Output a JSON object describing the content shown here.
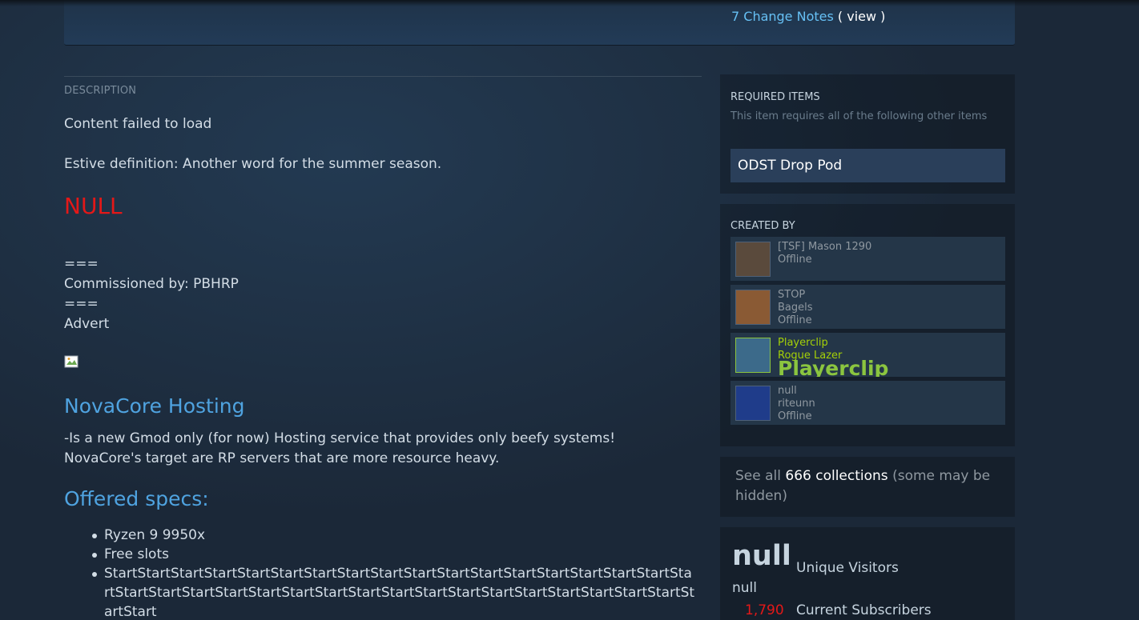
{
  "header": {
    "change_notes_link": "7 Change Notes",
    "view_text": "( view )"
  },
  "description": {
    "section_title": "DESCRIPTION",
    "lines": [
      "Content failed to load",
      "Estive definition: Another word for the summer season."
    ],
    "null_heading": "NULL",
    "separator_1": "===",
    "commissioned": "Commissioned by: PBHRP",
    "separator_2": "===",
    "advert": "Advert",
    "hosting_title": "NovaCore Hosting",
    "hosting_line_1": "-Is a new Gmod only (for now) Hosting service that provides only beefy systems!",
    "hosting_line_2": "NovaCore's target are RP servers that are more resource heavy.",
    "specs_title": "Offered specs:",
    "specs": [
      "Ryzen 9 9950x",
      "Free slots",
      "StartStartStartStartStartStartStartStartStartStartStartStartStartStartStartStartStartStartStartStartStartStartStartStartStartStartStartStartStartStartStartStartStartStartStartStartStart"
    ]
  },
  "required_items": {
    "title": "REQUIRED ITEMS",
    "subtitle": "This item requires all of the following other items",
    "items": [
      "ODST Drop Pod"
    ]
  },
  "created_by": {
    "title": "CREATED BY",
    "creators": [
      {
        "line1": "[TSF] Mason 1290",
        "line2": "Offline",
        "line3": "",
        "avatar_color": "#5a4a3c"
      },
      {
        "line1": "STOP",
        "line2": "Bagels",
        "line3": "Offline",
        "avatar_color": "#8a5a34"
      },
      {
        "line1": "Playerclip",
        "line2": "Rogue Lazer",
        "line3": "Playerclip",
        "avatar_color": "#3c6a8a"
      },
      {
        "line1": "null",
        "line2": "riteunn",
        "line3": "Offline",
        "avatar_color": "#1f3c8a"
      }
    ]
  },
  "collections": {
    "prefix": "See all",
    "link": "666 collections",
    "suffix": "(some may be hidden)"
  },
  "stats": {
    "unique_visitors_value": "null",
    "unique_visitors_label": "Unique Visitors",
    "extra_value": "null",
    "current_subscribers_value": "1,790",
    "current_subscribers_label": "Current Subscribers"
  },
  "colors": {
    "background": "#1b2838",
    "link_blue": "#66c0f4",
    "heading_blue": "#4fa3e0",
    "null_red": "#e41818",
    "online_green": "#a4d007"
  }
}
